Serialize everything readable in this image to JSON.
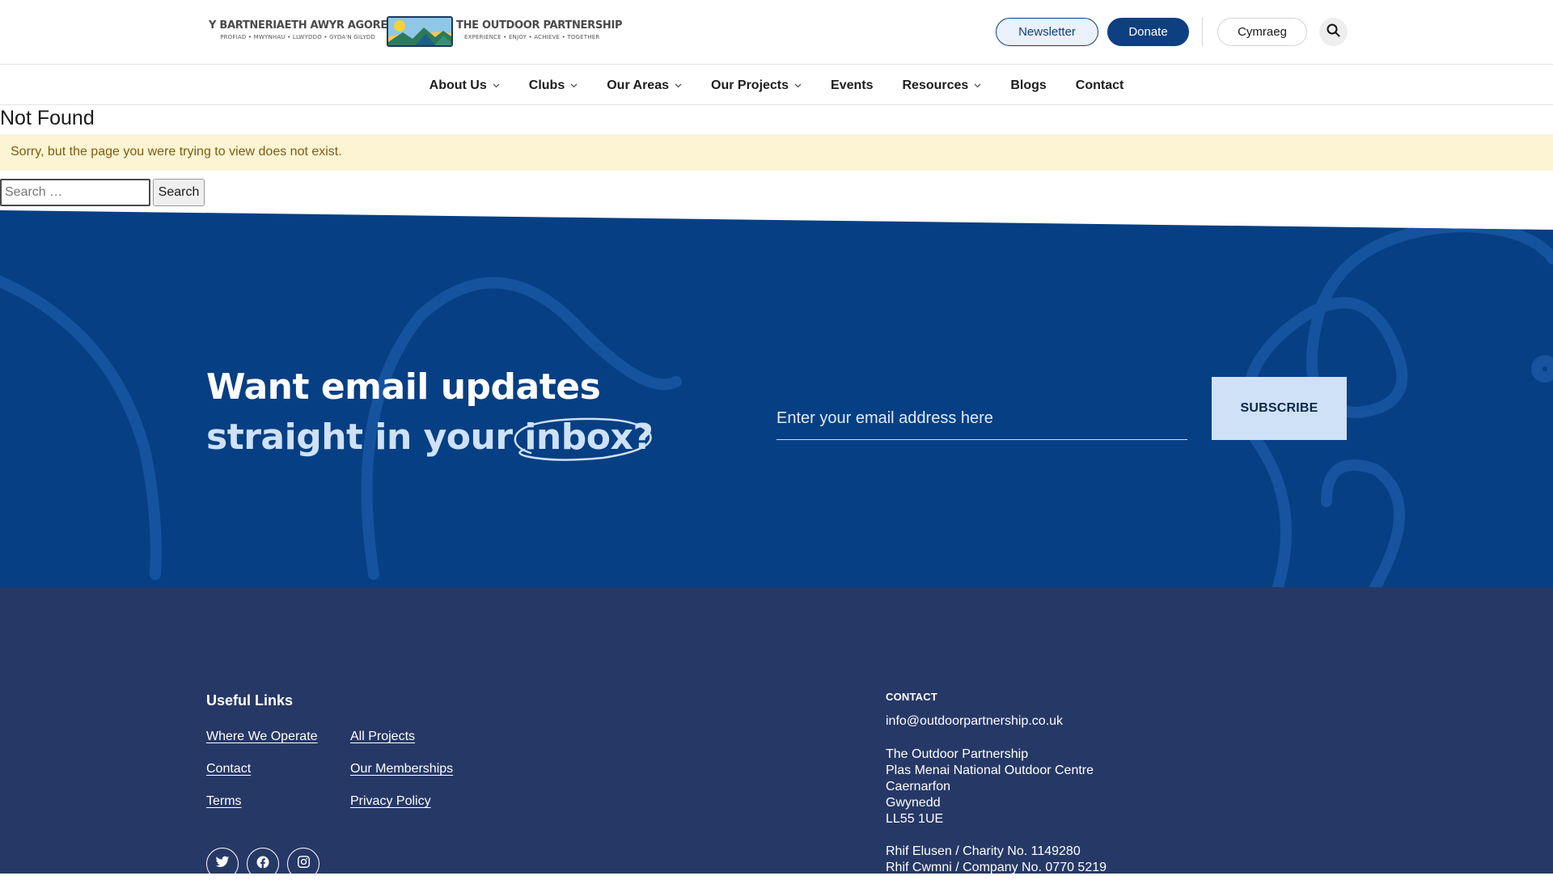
{
  "colors": {
    "brand_navy": "#0e3f80",
    "band_blue": "#063f83",
    "footer_navy": "#263866",
    "light_blue": "#cfe1f7",
    "alert_bg": "#fcf4d3",
    "alert_text": "#7a5e10"
  },
  "header": {
    "logo": {
      "welsh_name": "Y BARTNERIAETH AWYR AGORED",
      "welsh_tagline": "PROFIAD • MWYNHAU • LLWYDDO • GYDA'N GILYDD",
      "english_name": "THE OUTDOOR PARTNERSHIP",
      "english_tagline": "EXPERIENCE • ENJOY • ACHIEVE • TOGETHER"
    },
    "newsletter_label": "Newsletter",
    "donate_label": "Donate",
    "language_label": "Cymraeg",
    "search_icon": "search-icon"
  },
  "nav": {
    "items": [
      {
        "label": "About Us",
        "has_dropdown": true
      },
      {
        "label": "Clubs",
        "has_dropdown": true
      },
      {
        "label": "Our Areas",
        "has_dropdown": true
      },
      {
        "label": "Our Projects",
        "has_dropdown": true
      },
      {
        "label": "Events",
        "has_dropdown": false
      },
      {
        "label": "Resources",
        "has_dropdown": true
      },
      {
        "label": "Blogs",
        "has_dropdown": false
      },
      {
        "label": "Contact",
        "has_dropdown": false
      }
    ]
  },
  "main": {
    "title": "Not Found",
    "alert": "Sorry, but the page you were trying to view does not exist.",
    "search_placeholder": "Search …",
    "search_button": "Search"
  },
  "newsletter": {
    "heading_line1": "Want email updates",
    "heading_line2_prefix": "straight in your ",
    "heading_line2_highlight": "inbox?",
    "email_placeholder": "Enter your email address here",
    "subscribe_label": "SUBSCRIBE"
  },
  "footer": {
    "useful_links_title": "Useful Links",
    "links_col1": [
      "Where We Operate",
      "Contact",
      "Terms"
    ],
    "links_col2": [
      "All Projects",
      "Our Memberships",
      "Privacy Policy"
    ],
    "social_icons": [
      "twitter-icon",
      "facebook-icon",
      "instagram-icon"
    ],
    "contact_title": "CONTACT",
    "contact_email": "info@outdoorpartnership.co.uk",
    "address": {
      "line1": "The Outdoor Partnership",
      "line2": "Plas Menai National Outdoor Centre",
      "line3": "Caernarfon",
      "line4": "Gwynedd",
      "line5": "LL55 1UE"
    },
    "charity_no": "Rhif Elusen / Charity No. 1149280",
    "company_no": "Rhif Cwmni / Company No. 0770 5219"
  }
}
